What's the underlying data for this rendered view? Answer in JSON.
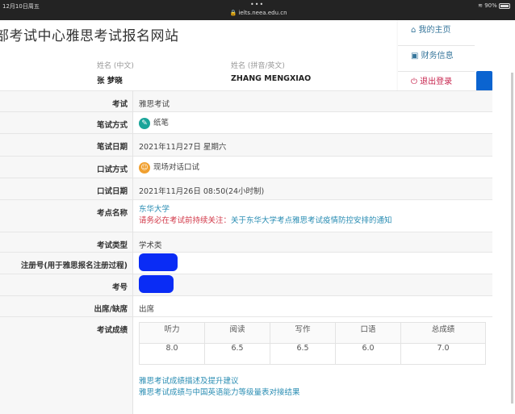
{
  "status_bar": {
    "time": "12月10日周五",
    "url": "ielts.neea.edu.cn",
    "battery": "90%",
    "battery_level": 0.9
  },
  "header": {
    "title": "部考试中心雅思考试报名网站"
  },
  "candidate": {
    "name_cn_label": "姓名 (中文)",
    "name_cn": "张  梦晓",
    "name_en_label": "姓名 (拼音/英文)",
    "name_en": "ZHANG  MENGXIAO"
  },
  "menu": [
    {
      "label": "我的主页",
      "icon": "home-icon"
    },
    {
      "label": "财务信息",
      "icon": "briefcase-icon"
    },
    {
      "label": "退出登录",
      "icon": "power-icon"
    }
  ],
  "rows": {
    "exam": {
      "label": "考试",
      "value": "雅思考试"
    },
    "written_mode": {
      "label": "笔试方式",
      "value": "纸笔",
      "icon": "pencil-icon"
    },
    "written_date": {
      "label": "笔试日期",
      "value": "2021年11月27日 星期六"
    },
    "speaking_mode": {
      "label": "口试方式",
      "value": "现场对话口试",
      "icon": "speaking-icon"
    },
    "speaking_date": {
      "label": "口试日期",
      "value": "2021年11月26日 08:50(24小时制)"
    },
    "venue": {
      "label": "考点名称",
      "value": "东华大学",
      "notice_prefix": "请务必在考试前持续关注：",
      "notice_link": "关于东华大学考点雅思考试疫情防控安排的通知"
    },
    "exam_type": {
      "label": "考试类型",
      "value": "学术类"
    },
    "registration_no": {
      "label": "注册号(用于雅思报名注册过程)"
    },
    "candidate_no": {
      "label": "考号"
    },
    "attendance": {
      "label": "出席/缺席",
      "value": "出席"
    },
    "scores": {
      "label": "考试成绩",
      "headers": [
        "听力",
        "阅读",
        "写作",
        "口语",
        "总成绩"
      ],
      "values": [
        "8.0",
        "6.5",
        "6.5",
        "6.0",
        "7.0"
      ],
      "links": [
        "雅思考试成绩描述及提升建议",
        "雅思考试成绩与中国英语能力等级量表对接结果"
      ]
    }
  }
}
